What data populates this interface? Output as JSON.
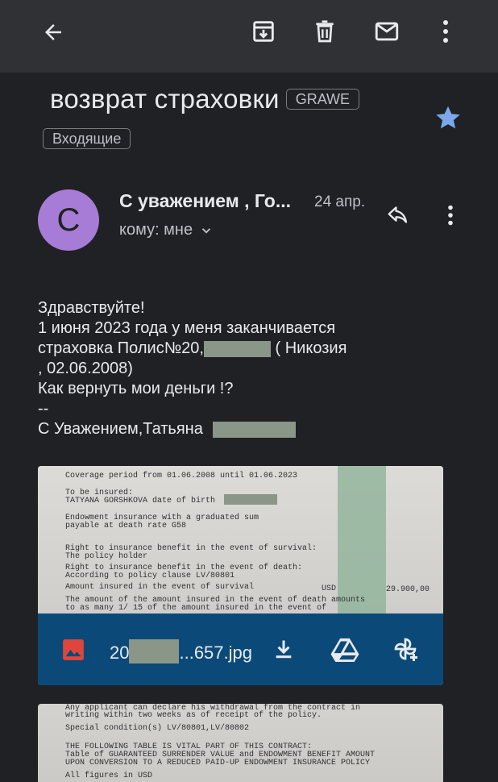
{
  "subject": "возврат страховки",
  "sender_tag": "GRAWE",
  "label": "Входящие",
  "sender": {
    "avatar_letter": "C",
    "name": "С уважением , Го...",
    "date": "24 апр.",
    "recipient": "кому: мне"
  },
  "body": {
    "line1": "Здравствуйте!",
    "line2": "1 июня 2023 года у меня заканчивается",
    "line3a": "страховка  Полис№20,",
    "line3b": " ( Никозия",
    "line4": ", 02.06.2008)",
    "line5": "Как вернуть мои деньги !?",
    "line6": "--",
    "line7": "С Уважением,Татьяна"
  },
  "attachment": {
    "name_prefix": "20",
    "name_suffix": "...657.jpg",
    "doc_lines": [
      "Coverage period from 01.06.2008 until 01.06.2023",
      "To be insured:",
      "TATYANA GORSHKOVA date of birth",
      "Endowment insurance with a graduated sum",
      "payable at death rate G58",
      "Right to insurance benefit in the event of survival:",
      "The policy holder",
      "Right to insurance benefit in the event of death:",
      "According to policy clause LV/80801",
      "Amount insured in the event of survival",
      "USD",
      "29.900,00",
      "The amount of the amount insured in the event of death amounts",
      "to as many 1/ 15 of the amount insured in the event of"
    ]
  },
  "attachment2": {
    "doc_lines": [
      "Any applicant can declare his withdrawal from the contract in",
      "writing within two weeks as of receipt of the policy.",
      "Special condition(s) LV/80801,LV/80802",
      "THE FOLLOWING TABLE IS VITAL PART OF THIS CONTRACT:",
      "Table of GUARANTEED SURRENDER VALUE and ENDOWMENT BENEFIT AMOUNT",
      "UPON CONVERSION TO A REDUCED PAID-UP ENDOWMENT INSURANCE POLICY",
      "All figures in USD"
    ]
  },
  "colors": {
    "background": "#202124",
    "appbar": "#303134",
    "avatar": "#a67cd6",
    "star": "#7ba7ec",
    "attachment_bar": "#0b4a78",
    "image_icon": "#e0453c"
  },
  "icons": {
    "back": "arrow-back-icon",
    "archive": "archive-icon",
    "delete": "trash-icon",
    "mark_unread": "mail-icon",
    "more": "more-vert-icon",
    "star": "star-icon",
    "reply": "reply-icon",
    "expand": "chevron-down-icon",
    "image": "image-icon",
    "download": "download-icon",
    "drive": "drive-icon",
    "photos_add": "photos-add-icon"
  }
}
